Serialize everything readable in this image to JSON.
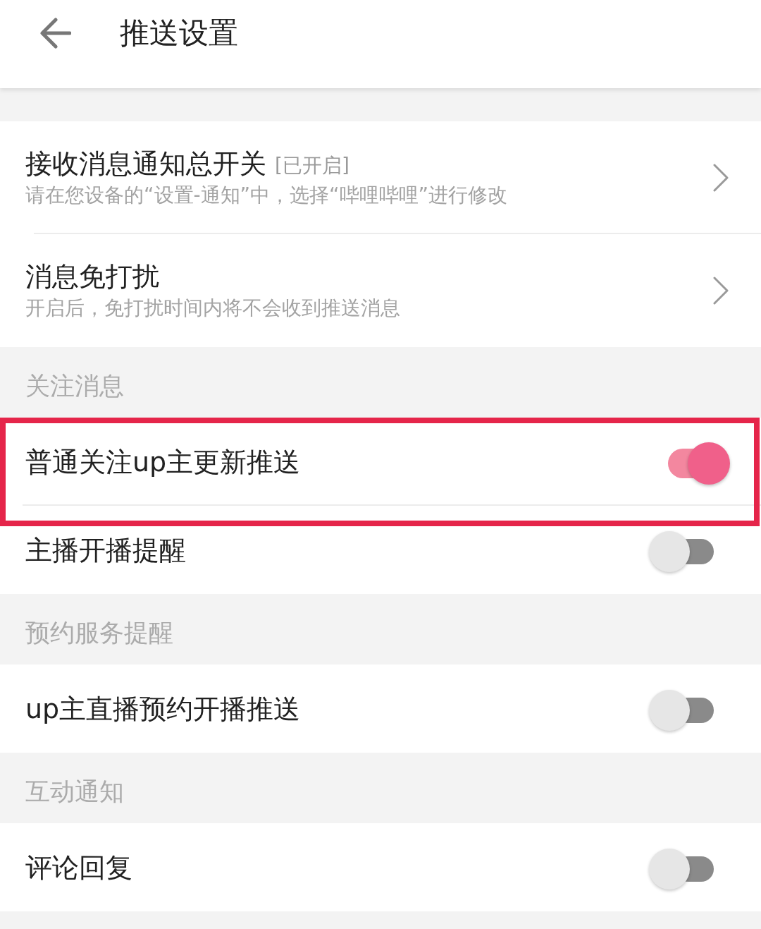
{
  "header": {
    "title": "推送设置"
  },
  "sections": [
    {
      "items": [
        {
          "kind": "link",
          "title": "接收消息通知总开关",
          "status": "[已开启]",
          "subtitle": "请在您设备的“设置-通知”中，选择“哔哩哔哩”进行修改",
          "highlighted": false
        },
        {
          "kind": "link",
          "title": "消息免打扰",
          "subtitle": "开启后，免打扰时间内将不会收到推送消息",
          "highlighted": false
        }
      ]
    },
    {
      "heading": "关注消息",
      "items": [
        {
          "kind": "switch",
          "title": "普通关注up主更新推送",
          "on": true,
          "highlighted": true
        },
        {
          "kind": "switch",
          "title": "主播开播提醒",
          "on": false,
          "highlighted": false
        }
      ]
    },
    {
      "heading": "预约服务提醒",
      "items": [
        {
          "kind": "switch",
          "title": "up主直播预约开播推送",
          "on": false,
          "highlighted": false
        }
      ]
    },
    {
      "heading": "互动通知",
      "items": [
        {
          "kind": "switch",
          "title": "评论回复",
          "on": false,
          "highlighted": false
        }
      ]
    }
  ]
}
